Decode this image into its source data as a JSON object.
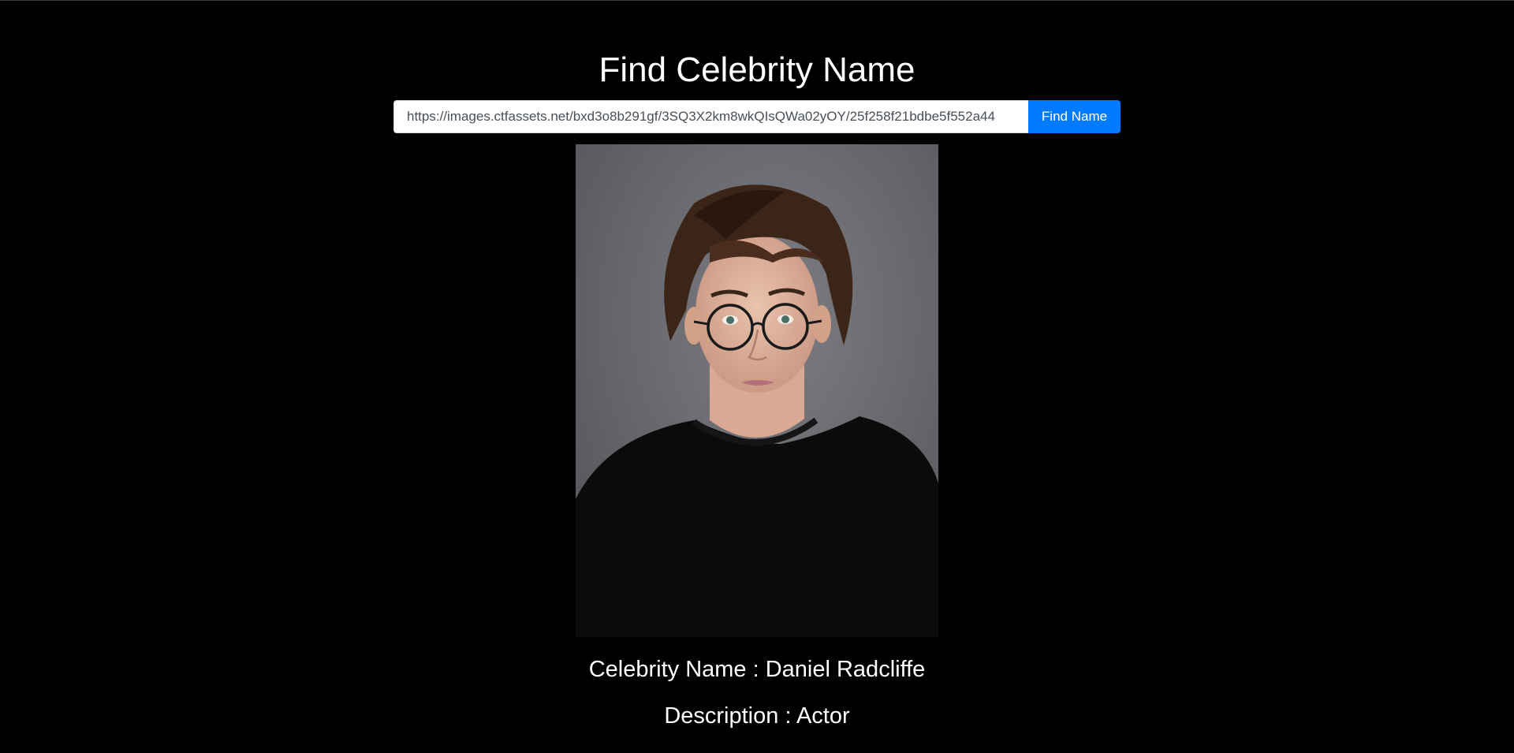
{
  "header": {
    "title": "Find Celebrity Name"
  },
  "search": {
    "url_value": "https://images.ctfassets.net/bxd3o8b291gf/3SQ3X2km8wkQIsQWa02yOY/25f258f21bdbe5f552a44",
    "button_label": "Find Name"
  },
  "result": {
    "name_line": "Celebrity Name : Daniel Radcliffe",
    "description_line": "Description : Actor"
  },
  "colors": {
    "background": "#000000",
    "button": "#007bff",
    "text": "#ffffff"
  }
}
